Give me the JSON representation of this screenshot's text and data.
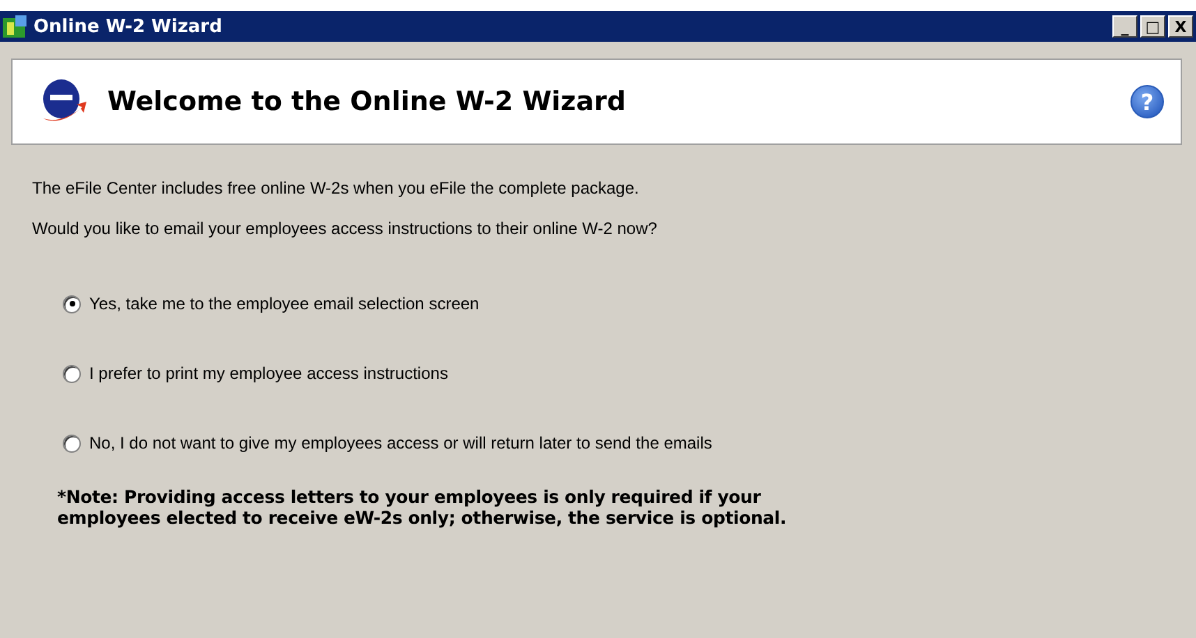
{
  "window": {
    "title": "Online W-2 Wizard",
    "controls": [
      "_",
      "□",
      "X"
    ]
  },
  "header": {
    "title": "Welcome to the Online W-2 Wizard",
    "help": "?"
  },
  "intro": [
    "The eFile Center includes free online W-2s when you eFile the complete package.",
    "Would you like to email your employees access instructions to their online W-2 now?"
  ],
  "options": [
    {
      "label": "Yes, take me to the employee email selection screen",
      "selected": true
    },
    {
      "label": "I prefer to print my employee access instructions",
      "selected": false
    },
    {
      "label": "No, I do not want to give my employees access or will return later to send the emails",
      "selected": false
    }
  ],
  "note": "*Note: Providing access letters to your employees is only required if your employees elected to receive eW-2s only; otherwise, the service is optional."
}
